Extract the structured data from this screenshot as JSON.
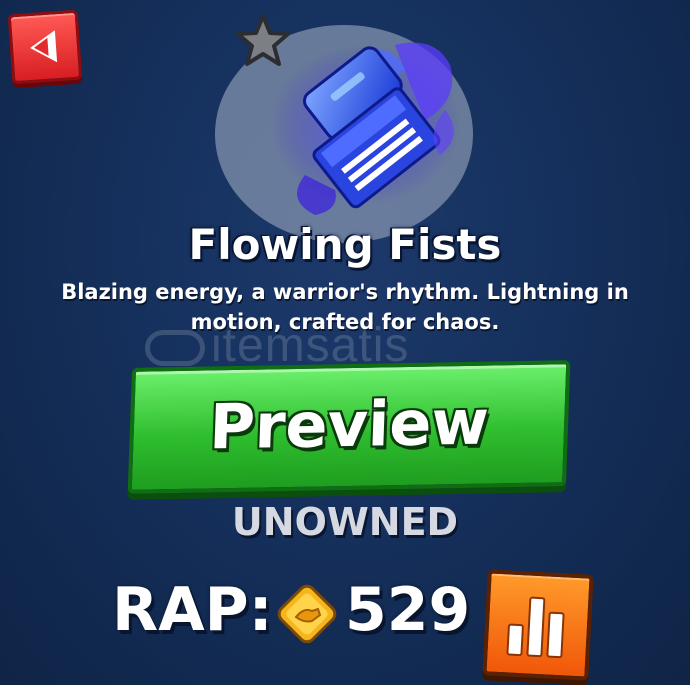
{
  "item": {
    "name": "Flowing Fists",
    "description": "Blazing energy, a warrior's rhythm. Lightning in motion, crafted for chaos.",
    "status": "UNOWNED",
    "favorite_icon": "star-icon"
  },
  "preview_button": {
    "label": "Preview"
  },
  "rap": {
    "label": "RAP:",
    "value": "529",
    "currency_icon": "coin-icon"
  },
  "watermark": {
    "text": "itemsatis"
  },
  "colors": {
    "background": "#15305c",
    "back_button": "#e52a2d",
    "preview_button": "#2fbe2f",
    "chart_button": "#f0570a",
    "item_glow": "#3a52ff"
  }
}
